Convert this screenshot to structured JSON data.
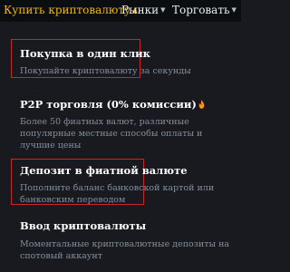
{
  "nav": {
    "items": [
      {
        "label": "Купить криптовалюту"
      },
      {
        "label": "Рынки"
      },
      {
        "label": "Торговать"
      }
    ]
  },
  "menu": {
    "items": [
      {
        "title": "Покупка в один клик",
        "desc": "Покупайте криптовалюту за секунды"
      },
      {
        "title": "P2P торговля (0% комиссии)",
        "desc": "Более 50 фиатных валют, различные популярные местные способы оплаты и лучшие цены"
      },
      {
        "title": "Депозит в фиатной валюте",
        "desc": "Пополните баланс банковской картой или банковским переводом"
      },
      {
        "title": "Ввод криптовалюты",
        "desc": "Моментальные криптовалютные депозиты на спотовый аккаунт"
      }
    ]
  },
  "colors": {
    "accent": "#f0b90b",
    "highlight": "#c8262c",
    "fire": "#f7931e"
  }
}
